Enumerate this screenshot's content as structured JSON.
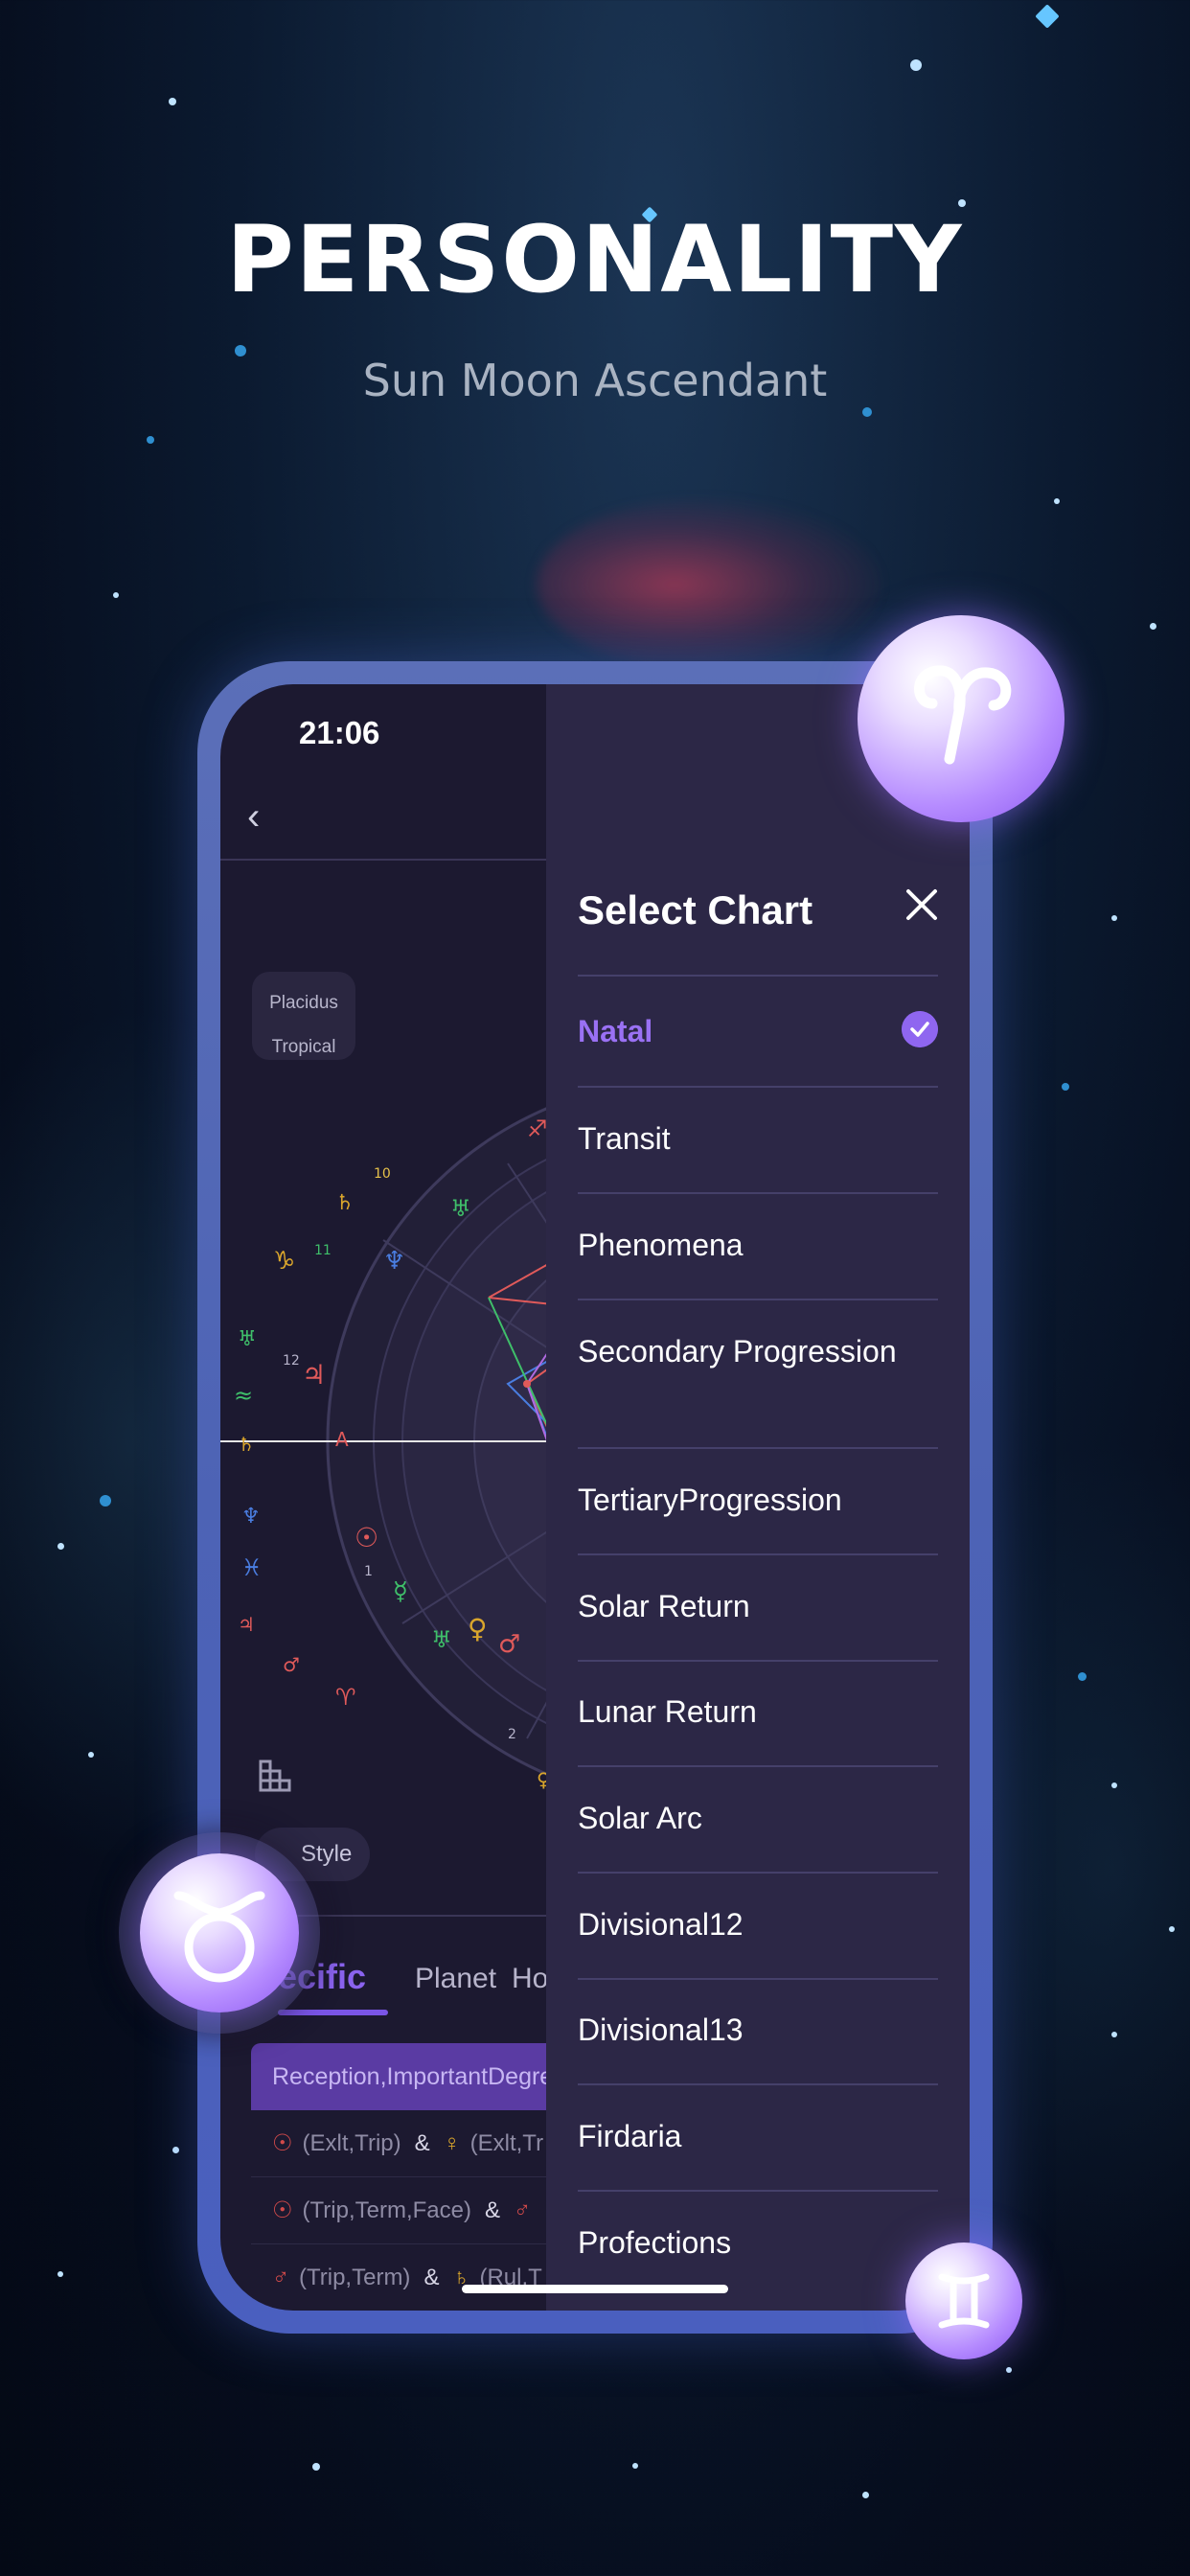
{
  "hero": {
    "title": "PERSONALITY",
    "subtitle": "Sun Moon Ascendant"
  },
  "status_bar": {
    "time": "21:06"
  },
  "chart_settings": {
    "house_system": "Placidus",
    "zodiac": "Tropical"
  },
  "controls": {
    "style_label": "Style"
  },
  "tabs": {
    "active": "ecific",
    "planet": "Planet",
    "house_partial": "Ho"
  },
  "table": {
    "header": "Reception,ImportantDegre",
    "rows": [
      {
        "left_sym": "☉",
        "left": "(Exlt,Trip)",
        "amp": "&",
        "right_sym": "♀",
        "right": "(Exlt,Tr"
      },
      {
        "left_sym": "☉",
        "left": "(Trip,Term,Face)",
        "amp": "&",
        "right_sym": "♂",
        "right": ""
      },
      {
        "left_sym": "♂",
        "left": "(Trip,Term)",
        "amp": "&",
        "right_sym": "♄",
        "right": "(Rul,T"
      }
    ]
  },
  "panel": {
    "title": "Select Chart",
    "options": [
      {
        "label": "Natal",
        "selected": true
      },
      {
        "label": "Transit",
        "selected": false
      },
      {
        "label": "Phenomena",
        "selected": false
      },
      {
        "label": "Secondary Progression",
        "selected": false
      },
      {
        "label": "TertiaryProgression",
        "selected": false
      },
      {
        "label": "Solar Return",
        "selected": false
      },
      {
        "label": "Lunar Return",
        "selected": false
      },
      {
        "label": "Solar Arc",
        "selected": false
      },
      {
        "label": "Divisional12",
        "selected": false
      },
      {
        "label": "Divisional13",
        "selected": false
      },
      {
        "label": "Firdaria",
        "selected": false
      },
      {
        "label": "Profections",
        "selected": false
      }
    ]
  },
  "badges": {
    "aries": "aries-icon",
    "taurus": "taurus-icon",
    "gemini": "gemini-icon"
  },
  "colors": {
    "accent": "#8f66f0",
    "panel_bg": "#2c2746",
    "frame": "#4d63b5"
  }
}
